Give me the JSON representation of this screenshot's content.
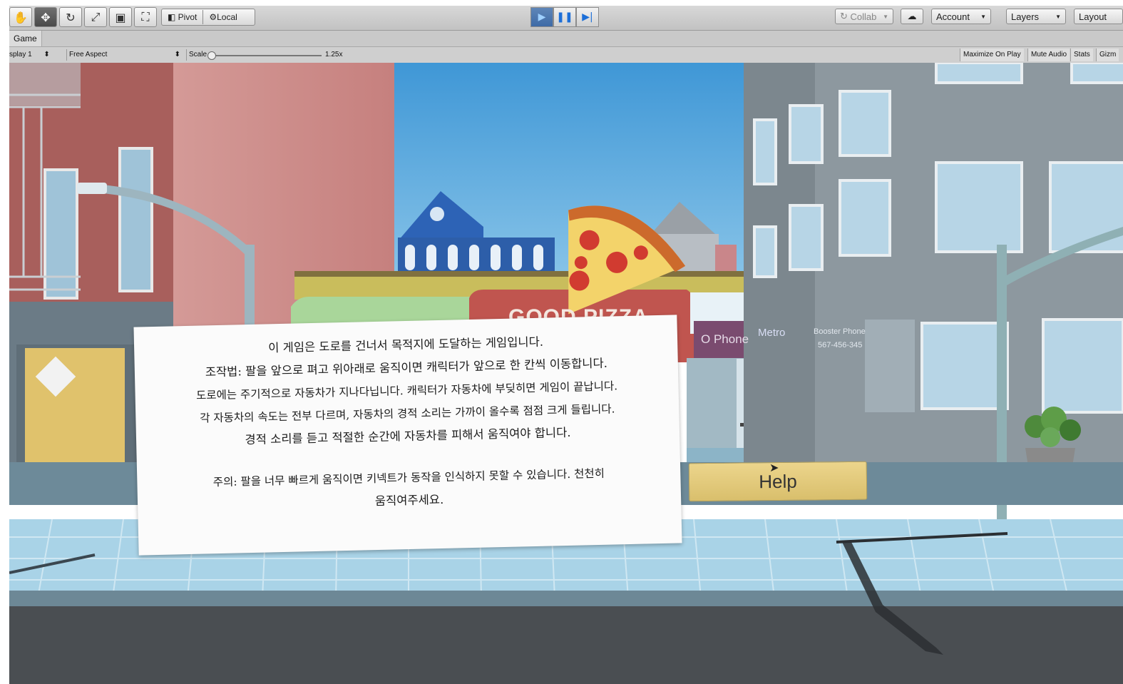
{
  "toolbar": {
    "transform_tools": [
      {
        "icon": "hand-icon",
        "glyph": "✋"
      },
      {
        "icon": "move-icon",
        "glyph": "✥",
        "active": true
      },
      {
        "icon": "rotate-icon",
        "glyph": "↻"
      },
      {
        "icon": "scale-icon",
        "glyph": "⤢"
      },
      {
        "icon": "rect-icon",
        "glyph": "▣"
      },
      {
        "icon": "transform-icon",
        "glyph": "⛶"
      }
    ],
    "pivot_label": "Pivot",
    "local_label": "Local",
    "collab_label": "Collab",
    "account_label": "Account",
    "layers_label": "Layers",
    "layout_label": "Layout"
  },
  "tab": {
    "label": "Game"
  },
  "game_bar": {
    "display": "splay 1",
    "aspect": "Free Aspect",
    "scale_label": "Scale",
    "scale_value": "1.25x",
    "maximize_label": "Maximize On Play",
    "mute_label": "Mute Audio",
    "stats_label": "Stats",
    "gizmos_label": "Gizm"
  },
  "scene": {
    "shop_sign": "GOOD PIZZA",
    "phone_sign": "O Phone",
    "metro_sign": "Metro",
    "booster_sign": "Booster Phone",
    "booster_number": "567-456-345"
  },
  "panel": {
    "lines": [
      "이 게임은 도로를 건너서 목적지에 도달하는 게임입니다.",
      "조작법: 팔을 앞으로 펴고 위아래로 움직이면 캐릭터가 앞으로 한 칸씩 이동합니다.",
      "도로에는 주기적으로 자동차가 지나다닙니다. 캐릭터가 자동차에 부딪히면 게임이 끝납니다.",
      "각 자동차의 속도는 전부 다르며, 자동차의 경적 소리는 가까이 올수록 점점 크게 들립니다.",
      "경적 소리를 듣고 적절한 순간에 자동차를 피해서 움직여야 합니다."
    ],
    "note_lines": [
      "주의: 팔을 너무 빠르게 움직이면 키넥트가 동작을 인식하지 못할 수 있습니다. 천천히",
      "움직여주세요."
    ]
  },
  "help_button": {
    "label": "Help"
  }
}
